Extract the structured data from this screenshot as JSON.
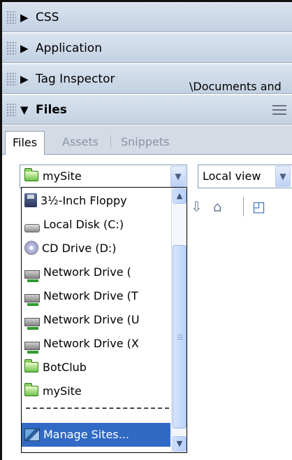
{
  "panels": [
    {
      "label": "CSS",
      "expanded": false
    },
    {
      "label": "Application",
      "expanded": false
    },
    {
      "label": "Tag Inspector",
      "expanded": false
    },
    {
      "label": "Files",
      "expanded": true
    }
  ],
  "tabs": [
    "Files",
    "Assets",
    "Snippets"
  ],
  "site_select": {
    "value": "mySite"
  },
  "view_select": {
    "value": "Local view"
  },
  "path_text": "\\Documents and",
  "dropdown": {
    "items": [
      {
        "label": "3½-Inch Floppy",
        "icon": "floppy-icon"
      },
      {
        "label": "Local Disk (C:)",
        "icon": "local-disk-icon"
      },
      {
        "label": "CD Drive (D:)",
        "icon": "cd-drive-icon"
      },
      {
        "label": "Network Drive (",
        "icon": "network-drive-icon"
      },
      {
        "label": "Network Drive (T",
        "icon": "network-drive-icon"
      },
      {
        "label": "Network Drive (U",
        "icon": "network-drive-icon"
      },
      {
        "label": "Network Drive (X",
        "icon": "network-drive-icon"
      },
      {
        "label": "BotClub",
        "icon": "folder-icon"
      },
      {
        "label": "mySite",
        "icon": "folder-icon"
      }
    ],
    "divider": "------------------",
    "manage_label": "Manage Sites..."
  }
}
